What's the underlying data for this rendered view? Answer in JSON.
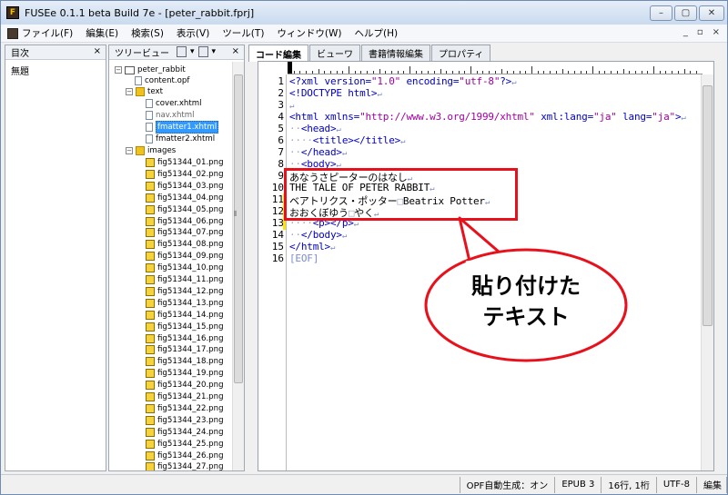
{
  "window": {
    "title": "FUSEe 0.1.1 beta Build 7e - [peter_rabbit.fprj]",
    "app_icon_glyph": "F",
    "buttons": [
      "–",
      "▢",
      "✕"
    ]
  },
  "menubar": {
    "items": [
      "ファイル(F)",
      "編集(E)",
      "検索(S)",
      "表示(V)",
      "ツール(T)",
      "ウィンドウ(W)",
      "ヘルプ(H)"
    ],
    "mdi_controls": [
      "_",
      "▫",
      "×"
    ]
  },
  "toc_pane": {
    "title": "目次",
    "close": "×",
    "items": [
      "無題"
    ]
  },
  "tree_pane": {
    "title": "ツリービュー",
    "close": "×",
    "project": "peter_rabbit",
    "content_file": "content.opf",
    "text_folder": "text",
    "text_files": [
      "cover.xhtml",
      "nav.xhtml",
      "fmatter1.xhtml",
      "fmatter2.xhtml"
    ],
    "selected_file": "fmatter1.xhtml",
    "images_folder": "images",
    "image_files": [
      "fig51344_01.png",
      "fig51344_02.png",
      "fig51344_03.png",
      "fig51344_04.png",
      "fig51344_05.png",
      "fig51344_06.png",
      "fig51344_07.png",
      "fig51344_08.png",
      "fig51344_09.png",
      "fig51344_10.png",
      "fig51344_11.png",
      "fig51344_12.png",
      "fig51344_13.png",
      "fig51344_14.png",
      "fig51344_15.png",
      "fig51344_16.png",
      "fig51344_17.png",
      "fig51344_18.png",
      "fig51344_19.png",
      "fig51344_20.png",
      "fig51344_21.png",
      "fig51344_22.png",
      "fig51344_23.png",
      "fig51344_24.png",
      "fig51344_25.png",
      "fig51344_26.png",
      "fig51344_27.png"
    ]
  },
  "tabs": [
    "コード編集",
    "ビューワ",
    "書籍情報編集",
    "プロパティ"
  ],
  "active_tab": "コード編集",
  "code": {
    "line_numbers": [
      "1",
      "2",
      "3",
      "4",
      "5",
      "6",
      "7",
      "8",
      "9",
      "10",
      "11",
      "12",
      "13",
      "14",
      "15",
      "16"
    ],
    "l1a": "<?xml version=",
    "l1b": "\"1.0\"",
    "l1c": " encoding=",
    "l1d": "\"utf-8\"",
    "l1e": "?>",
    "l2": "<!DOCTYPE html>",
    "l4a": "<html xmlns=",
    "l4b": "\"http://www.w3.org/1999/xhtml\"",
    "l4c": " xml:lang=",
    "l4d": "\"ja\"",
    "l4e": " lang=",
    "l4f": "\"ja\"",
    "l4g": ">",
    "l5": "<head>",
    "l6": "<title></title>",
    "l7": "</head>",
    "l8": "<body>",
    "l9": "あなうさピーターのはなし",
    "l10": "THE TALE OF PETER RABBIT",
    "l11a": "ベアトリクス・ポッター",
    "l11b": "Beatrix Potter",
    "l12a": "おおくぼゆう",
    "l12b": "やく",
    "l13": "<p></p>",
    "l14": "</body>",
    "l15": "</html>",
    "l16": "[EOF]",
    "eol": "↵",
    "wide_space": "□"
  },
  "annotation": {
    "line1": "貼り付けた",
    "line2": "テキスト"
  },
  "statusbar": {
    "opf": "OPF自動生成：オン",
    "epub": "EPUB 3",
    "position": "16行, 1桁",
    "encoding": "UTF-8",
    "mode": "編集"
  },
  "colors": {
    "highlight_box": "#e8101a",
    "tag": "#0000c8",
    "string": "#a000a0",
    "selection": "#3399ff"
  }
}
